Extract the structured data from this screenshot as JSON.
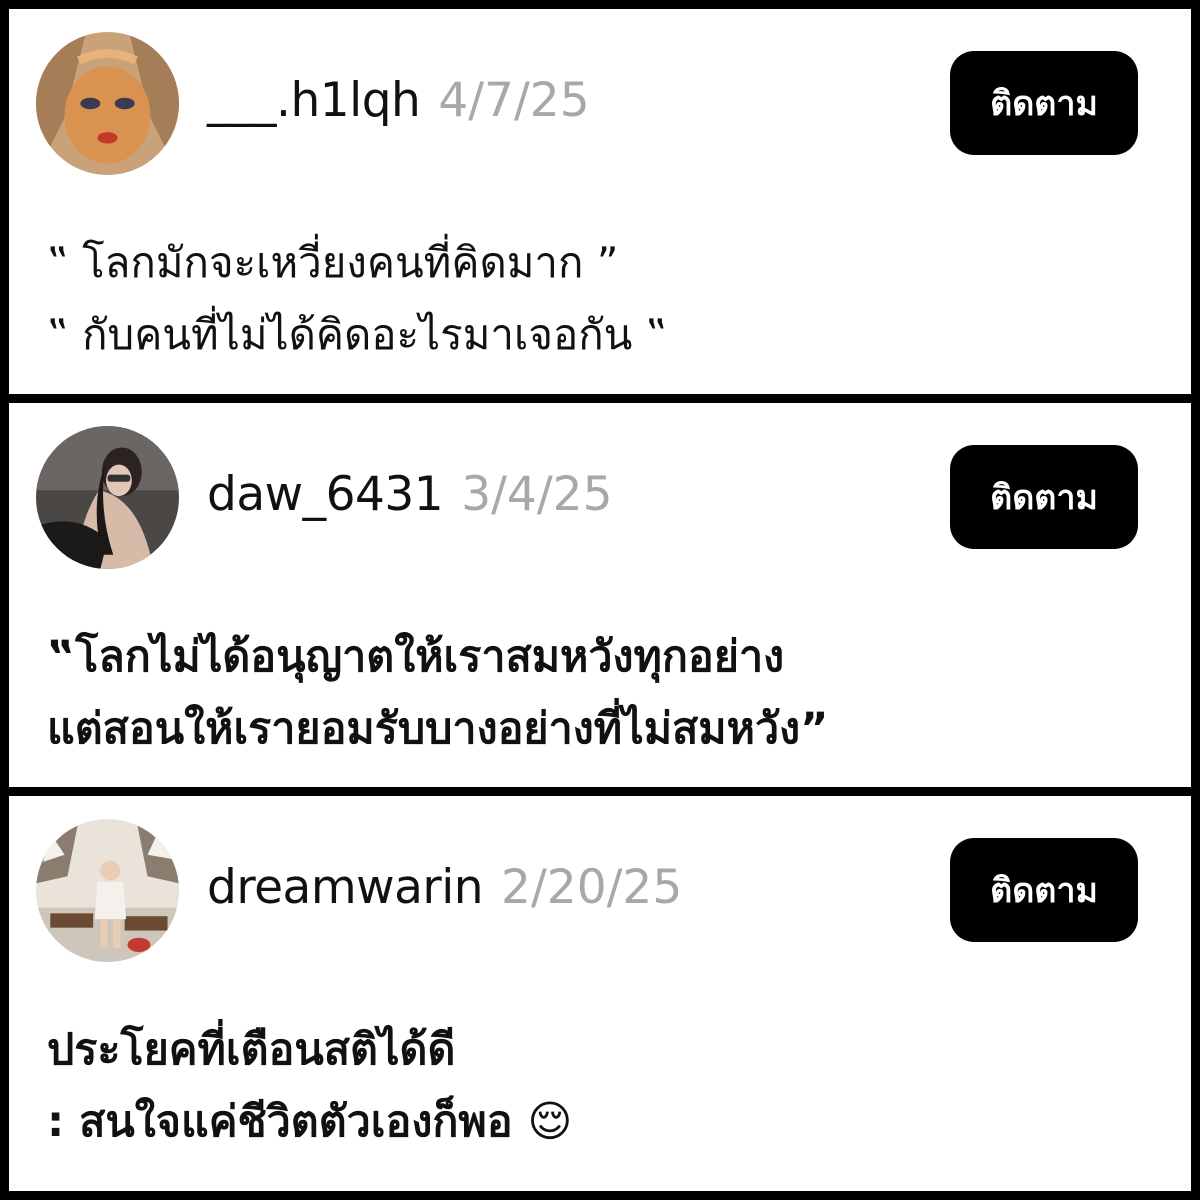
{
  "posts": [
    {
      "username": "___.h1lqh",
      "date": "4/7/25",
      "follow_label": "ติดตาม",
      "lines": [
        "‟ โลกมักจะเหวี่ยงคนที่คิดมาก ”",
        "‟ กับคนที่ไม่ได้คิดอะไรมาเจอกัน ‟"
      ]
    },
    {
      "username": "daw_6431",
      "date": "3/4/25",
      "follow_label": "ติดตาม",
      "lines": [
        "‟โลกไม่ได้อนุญาตให้เราสมหวังทุกอย่าง",
        "แต่สอนให้เรายอมรับบางอย่างที่ไม่สมหวัง”"
      ]
    },
    {
      "username": "dreamwarin",
      "date": "2/20/25",
      "follow_label": "ติดตาม",
      "lines": [
        "ประโยคที่เตือนสติได้ดี",
        ": สนใจแค่ชีวิตตัวเองก็พอ 😌"
      ]
    }
  ]
}
